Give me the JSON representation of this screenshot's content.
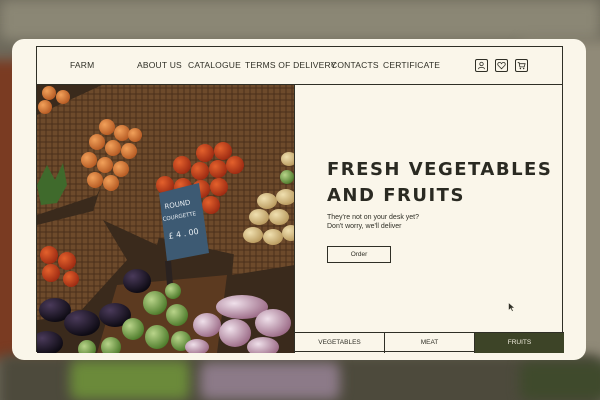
{
  "nav": {
    "brand": "FARM",
    "links": [
      "ABOUT US",
      "CATALOGUE",
      "TERMS OF DELIVERY",
      "CONTACTS",
      "CERTIFICATE"
    ],
    "icons": [
      "user-icon",
      "heart-icon",
      "cart-icon"
    ]
  },
  "hero": {
    "title_line1": "FRESH VEGETABLES",
    "title_line2": "AND FRUITS",
    "subtitle_line1": "They're not on your desk yet?",
    "subtitle_line2": "Don't worry, we'll deliver",
    "order_label": "Order"
  },
  "photo": {
    "sign_line1": "ROUND",
    "sign_line2": "COURGETTE",
    "sign_price": "£ 4 . 00"
  },
  "tabs": {
    "items": [
      "VEGETABLES",
      "MEAT",
      "FRUITS"
    ],
    "active": "FRUITS"
  },
  "colors": {
    "background": "#faf6ea",
    "text": "#2f2f26",
    "accent": "#3d4427"
  }
}
